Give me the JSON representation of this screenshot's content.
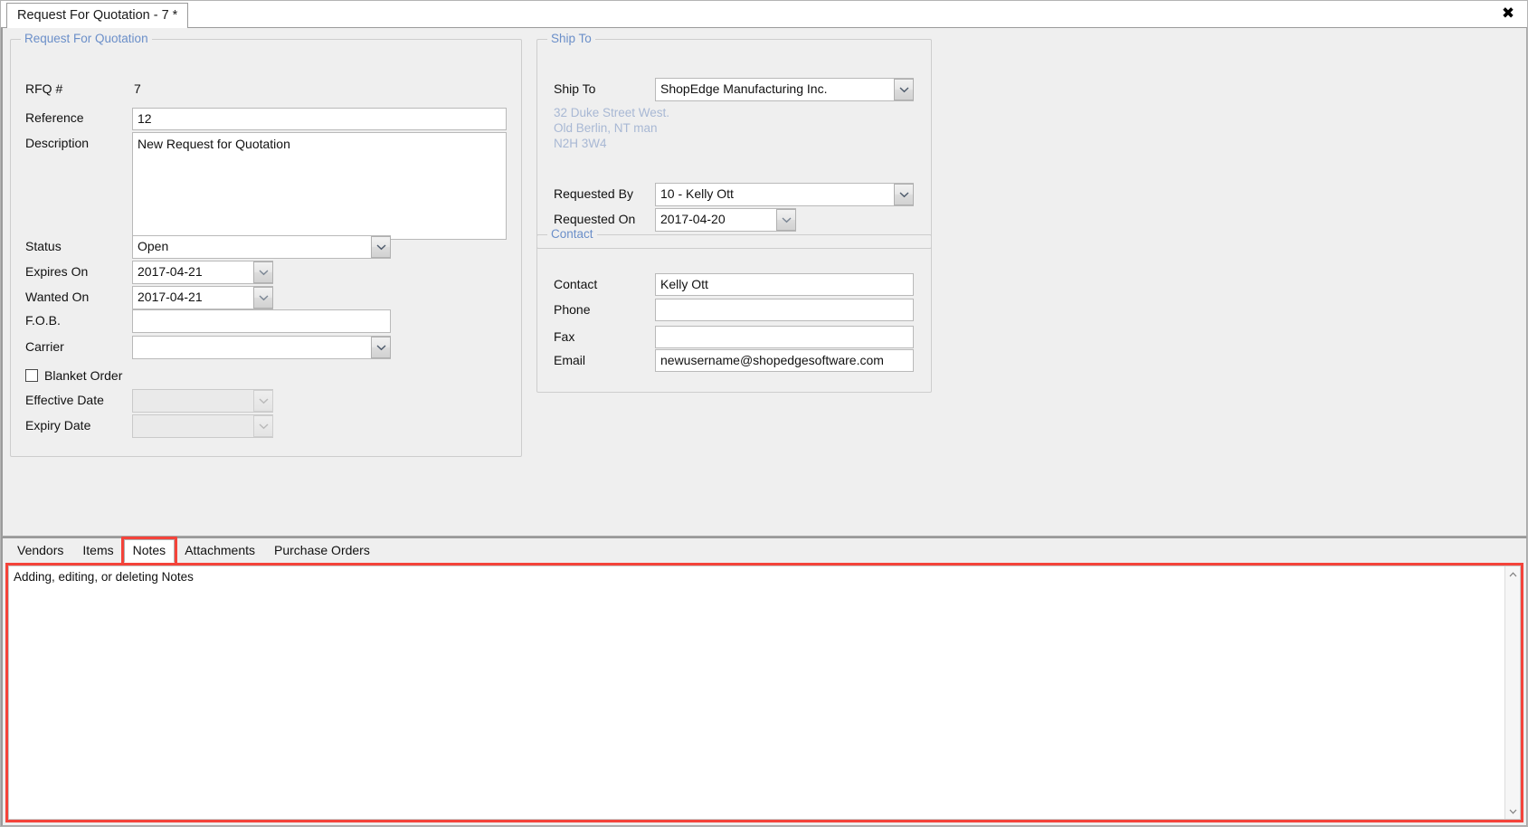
{
  "window": {
    "document_tab": "Request For Quotation - 7 *",
    "close_label": "✖"
  },
  "rfq_group": {
    "title": "Request For Quotation",
    "fields": {
      "rfq_number_label": "RFQ #",
      "rfq_number_value": "7",
      "reference_label": "Reference",
      "reference_value": "12",
      "description_label": "Description",
      "description_value": "New Request for Quotation",
      "status_label": "Status",
      "status_value": "Open",
      "expires_on_label": "Expires On",
      "expires_on_value": "2017-04-21",
      "wanted_on_label": "Wanted On",
      "wanted_on_value": "2017-04-21",
      "fob_label": "F.O.B.",
      "fob_value": "",
      "carrier_label": "Carrier",
      "carrier_value": "",
      "blanket_order_label": "Blanket Order",
      "effective_date_label": "Effective Date",
      "effective_date_value": "",
      "expiry_date_label": "Expiry Date",
      "expiry_date_value": ""
    }
  },
  "ship_to_group": {
    "title": "Ship To",
    "ship_to_label": "Ship To",
    "ship_to_value": "ShopEdge Manufacturing Inc.",
    "address_line_1": "32 Duke Street West.",
    "address_line_2": "Old Berlin, NT man",
    "address_line_3": "N2H 3W4",
    "requested_by_label": "Requested By",
    "requested_by_value": "10 - Kelly Ott",
    "requested_on_label": "Requested On",
    "requested_on_value": "2017-04-20"
  },
  "contact_group": {
    "title": "Contact",
    "contact_label": "Contact",
    "contact_value": "Kelly Ott",
    "phone_label": "Phone",
    "phone_value": "",
    "fax_label": "Fax",
    "fax_value": "",
    "email_label": "Email",
    "email_value": "newusername@shopedgesoftware.com"
  },
  "bottom_tabs": {
    "items": [
      {
        "label": "Vendors",
        "active": false
      },
      {
        "label": "Items",
        "active": false
      },
      {
        "label": "Notes",
        "active": true
      },
      {
        "label": "Attachments",
        "active": false
      },
      {
        "label": "Purchase Orders",
        "active": false
      }
    ]
  },
  "notes_panel": {
    "text": "Adding, editing, or deleting Notes"
  },
  "colors": {
    "group_title": "#6b8fc9",
    "highlight": "#f4433a",
    "address_text": "#a8b8d4",
    "panel_bg": "#efefef"
  }
}
